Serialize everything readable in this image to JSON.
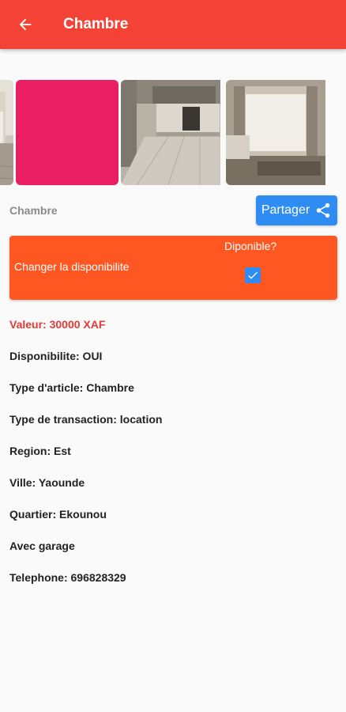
{
  "appbar": {
    "title": "Chambre",
    "back_icon": "arrow-back-icon",
    "color": "#f44336"
  },
  "gallery": {
    "images": [
      "bathroom-photo",
      "pink-placeholder",
      "kitchen-photo",
      "living-room-photo"
    ]
  },
  "item": {
    "name": "Chambre",
    "share_label": "Partager",
    "share_color": "#2f8cf3"
  },
  "availability": {
    "label": "Changer la disponibilite",
    "question": "Diponible?",
    "checked": true,
    "color": "#ff5722"
  },
  "details": {
    "price": "Valeur: 30000 XAF",
    "availability": "Disponibilite: OUI",
    "type": "Type d'article: Chambre",
    "transaction": "Type de transaction: location",
    "region": "Region: Est",
    "city": "Ville: Yaounde",
    "district": "Quartier: Ekounou",
    "garage": "Avec garage",
    "phone": "Telephone: 696828329"
  }
}
